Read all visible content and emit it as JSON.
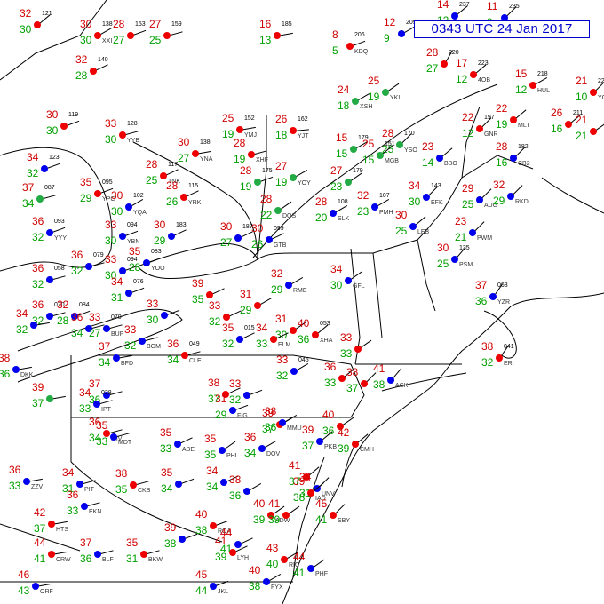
{
  "title": "0343 UTC 24 Jan 2017",
  "colors": {
    "temperature": "#d00000",
    "dewpoint": "#00a000",
    "boundaries": "#000000",
    "title": "#0000cc",
    "sky_clear": "#0000ee",
    "sky_cover": "#ee0000",
    "sky_obscured": "#22aa44",
    "weather_symbols": "#cc00cc"
  },
  "stations": [
    {
      "temp": "32",
      "dew": "30",
      "pres": "121"
    },
    {
      "temp": "30",
      "dew": "30",
      "pres": "138",
      "id": "XXI"
    },
    {
      "temp": "28",
      "dew": "27",
      "pres": "153"
    },
    {
      "temp": "27",
      "dew": "25",
      "pres": "159"
    },
    {
      "temp": "16",
      "dew": "13",
      "pres": "185"
    },
    {
      "temp": "8",
      "dew": "5",
      "pres": "206",
      "id": "KDQ"
    },
    {
      "temp": "12",
      "dew": "9",
      "pres": "209"
    },
    {
      "temp": "14",
      "dew": "12",
      "pres": "237"
    },
    {
      "temp": "11",
      "dew": "9",
      "pres": "235"
    },
    {
      "temp": "32",
      "dew": "28",
      "pres": "140"
    },
    {
      "temp": "28",
      "dew": "27",
      "pres": "220"
    },
    {
      "temp": "17",
      "dew": "12",
      "pres": "223",
      "id": "4OB"
    },
    {
      "temp": "15",
      "dew": "12",
      "pres": "218",
      "id": "HUL"
    },
    {
      "temp": "21",
      "dew": "10",
      "pres": "227",
      "id": "YCX"
    },
    {
      "temp": "30",
      "dew": "30",
      "pres": "119"
    },
    {
      "temp": "33",
      "dew": "30",
      "pres": "128",
      "id": "YYB"
    },
    {
      "temp": "25",
      "dew": "19",
      "pres": "152",
      "id": "YMJ"
    },
    {
      "temp": "26",
      "dew": "18",
      "pres": "162",
      "id": "YJT"
    },
    {
      "temp": "24",
      "dew": "18",
      "id": "XSH"
    },
    {
      "temp": "25",
      "dew": "19",
      "id": "YKL"
    },
    {
      "temp": "22",
      "dew": "12",
      "pres": "197",
      "id": "GNR"
    },
    {
      "temp": "22",
      "dew": "19",
      "id": "MLT"
    },
    {
      "temp": "26",
      "dew": "16",
      "pres": "211"
    },
    {
      "temp": "21",
      "dew": "21"
    },
    {
      "temp": "30",
      "dew": "27",
      "pres": "138",
      "id": "YNA"
    },
    {
      "temp": "28",
      "dew": "19",
      "id": "XHF"
    },
    {
      "temp": "28",
      "dew": "19",
      "pres": "175"
    },
    {
      "temp": "15",
      "dew": "15",
      "pres": "179"
    },
    {
      "temp": "28",
      "dew": "25",
      "pres": "170",
      "id": "YSO"
    },
    {
      "temp": "23",
      "dew": "14",
      "id": "BBO"
    },
    {
      "temp": "34",
      "dew": "32",
      "pres": "123"
    },
    {
      "temp": "28",
      "dew": "25",
      "pres": "117",
      "id": "TNK"
    },
    {
      "temp": "27",
      "dew": "19",
      "id": "YOY"
    },
    {
      "temp": "27",
      "dew": "23",
      "pres": "179"
    },
    {
      "temp": "25",
      "dew": "15",
      "pres": "151",
      "id": "MGB"
    },
    {
      "temp": "28",
      "dew": "16",
      "pres": "182",
      "id": "CB2"
    },
    {
      "temp": "37",
      "dew": "34",
      "pres": "087"
    },
    {
      "temp": "35",
      "dew": "29",
      "pres": "095",
      "id": "YPC"
    },
    {
      "temp": "28",
      "dew": "26",
      "pres": "115",
      "id": "YRK"
    },
    {
      "temp": "30",
      "dew": "30",
      "pres": "102",
      "id": "YQA"
    },
    {
      "temp": "28",
      "dew": "22",
      "id": "DQS"
    },
    {
      "temp": "28",
      "dew": "20",
      "pres": "108",
      "id": "SLK"
    },
    {
      "temp": "34",
      "dew": "30",
      "pres": "143",
      "id": "EFK"
    },
    {
      "temp": "29",
      "dew": "25",
      "id": "AUG"
    },
    {
      "temp": "32",
      "dew": "29",
      "id": "RKD"
    },
    {
      "temp": "36",
      "dew": "32",
      "pres": "093",
      "id": "YYY"
    },
    {
      "temp": "33",
      "dew": "30",
      "pres": "094",
      "id": "YBN"
    },
    {
      "temp": "30",
      "dew": "29",
      "pres": "183"
    },
    {
      "temp": "30",
      "dew": "27",
      "pres": "187"
    },
    {
      "temp": "30",
      "dew": "26",
      "pres": "099",
      "id": "GTB"
    },
    {
      "temp": "32",
      "dew": "23",
      "pres": "107",
      "id": "PMH"
    },
    {
      "temp": "30",
      "dew": "25",
      "id": "LEB"
    },
    {
      "temp": "23",
      "dew": "21",
      "id": "PWM"
    },
    {
      "temp": "36",
      "dew": "32",
      "pres": "058"
    },
    {
      "temp": "36",
      "dew": "32",
      "pres": "079"
    },
    {
      "temp": "33",
      "dew": "30",
      "pres": "094"
    },
    {
      "temp": "35",
      "dew": "28",
      "pres": "083",
      "id": "YOO"
    },
    {
      "temp": "32",
      "dew": "29",
      "id": "RME"
    },
    {
      "temp": "34",
      "dew": "30",
      "id": "GFL"
    },
    {
      "temp": "30",
      "dew": "25",
      "pres": "135",
      "id": "PSM"
    },
    {
      "temp": "36",
      "dew": "32",
      "pres": "070"
    },
    {
      "temp": "32",
      "dew": "28",
      "pres": "084"
    },
    {
      "temp": "34",
      "dew": "31",
      "pres": "076"
    },
    {
      "temp": "39",
      "dew": "35"
    },
    {
      "temp": "37",
      "dew": "36",
      "pres": "063",
      "id": "YZR"
    },
    {
      "temp": "34",
      "dew": "32"
    },
    {
      "temp": "36",
      "dew": "34"
    },
    {
      "temp": "33",
      "dew": "27",
      "pres": "070",
      "id": "BUF"
    },
    {
      "temp": "33",
      "dew": "30"
    },
    {
      "temp": "33",
      "dew": "32"
    },
    {
      "temp": "31",
      "dew": "29"
    },
    {
      "temp": "31",
      "dew": "30"
    },
    {
      "temp": "40",
      "dew": "36",
      "pres": "053",
      "id": "XHA"
    },
    {
      "temp": "38",
      "dew": "36",
      "id": "DKK"
    },
    {
      "temp": "33",
      "dew": "32",
      "id": "BGM"
    },
    {
      "temp": "34",
      "dew": "33",
      "id": "ELM"
    },
    {
      "temp": "35",
      "dew": "32",
      "pres": "015"
    },
    {
      "temp": "33",
      "dew": "32",
      "pres": "045"
    },
    {
      "temp": "33",
      "dew": "33"
    },
    {
      "temp": "36",
      "dew": "33"
    },
    {
      "temp": "38",
      "dew": "37"
    },
    {
      "temp": "41",
      "dew": "38",
      "id": "ACK"
    },
    {
      "temp": "38",
      "dew": "32",
      "pres": "041",
      "id": "ERI"
    },
    {
      "temp": "37",
      "dew": "34",
      "id": "BFD"
    },
    {
      "temp": "36",
      "dew": "34",
      "pres": "049",
      "id": "CLE"
    },
    {
      "temp": "39",
      "dew": "37"
    },
    {
      "temp": "37",
      "dew": "36"
    },
    {
      "temp": "34",
      "dew": "33",
      "pres": "028",
      "id": "IPT"
    },
    {
      "temp": "33",
      "dew": "32"
    },
    {
      "temp": "38",
      "dew": "37"
    },
    {
      "temp": "39",
      "dew": "37"
    },
    {
      "temp": "40",
      "dew": "36"
    },
    {
      "temp": "41",
      "dew": "37"
    },
    {
      "temp": "34",
      "dew": "31",
      "id": "UNV"
    },
    {
      "temp": "31",
      "dew": "29",
      "id": "FIG"
    },
    {
      "temp": "35",
      "dew": "33",
      "id": "ABE"
    },
    {
      "temp": "38",
      "dew": "36",
      "id": "MMU"
    },
    {
      "temp": "35",
      "dew": "35",
      "id": "PHL"
    },
    {
      "temp": "36",
      "dew": "34",
      "id": "MIV"
    },
    {
      "temp": "42",
      "dew": "39",
      "id": "CMH"
    },
    {
      "temp": "36",
      "dew": "33",
      "id": "ZZV"
    },
    {
      "temp": "34",
      "dew": "31",
      "id": "PIT"
    },
    {
      "temp": "35",
      "dew": "33",
      "id": "MDT"
    },
    {
      "temp": "36",
      "dew": "34",
      "id": "DOV"
    },
    {
      "temp": "39",
      "dew": "37",
      "id": "PKB"
    },
    {
      "temp": "36",
      "dew": "33",
      "id": "EKN"
    },
    {
      "temp": "38",
      "dew": "35",
      "id": "CKB"
    },
    {
      "temp": "35",
      "dew": "34"
    },
    {
      "temp": "34",
      "dew": "34"
    },
    {
      "temp": "38",
      "dew": "36"
    },
    {
      "temp": "39",
      "dew": "38",
      "id": "IAD"
    },
    {
      "temp": "40",
      "dew": "39",
      "id": "ADW"
    },
    {
      "temp": "41",
      "dew": "39"
    },
    {
      "temp": "45",
      "dew": "41",
      "id": "SBY"
    },
    {
      "temp": "42",
      "dew": "37",
      "id": "HTS"
    },
    {
      "temp": "44",
      "dew": "41",
      "id": "CRW"
    },
    {
      "temp": "37",
      "dew": "36",
      "id": "BLF"
    },
    {
      "temp": "35",
      "dew": "31",
      "id": "BKW"
    },
    {
      "temp": "40",
      "dew": "38",
      "id": "ROA"
    },
    {
      "temp": "41",
      "dew": "39",
      "id": "LYH"
    },
    {
      "temp": "43",
      "dew": "40",
      "id": "RIC"
    },
    {
      "temp": "44",
      "dew": "41",
      "id": "PHF"
    },
    {
      "temp": "46",
      "dew": "43",
      "id": "ORF"
    },
    {
      "temp": "45",
      "dew": "44",
      "id": "JKL"
    },
    {
      "temp": "40",
      "dew": "38",
      "id": "FYX"
    },
    {
      "temp": "39",
      "dew": "38"
    },
    {
      "temp": "44",
      "dew": "41"
    },
    {
      "temp": "38",
      "dew": "37",
      "id": "LKU"
    }
  ]
}
